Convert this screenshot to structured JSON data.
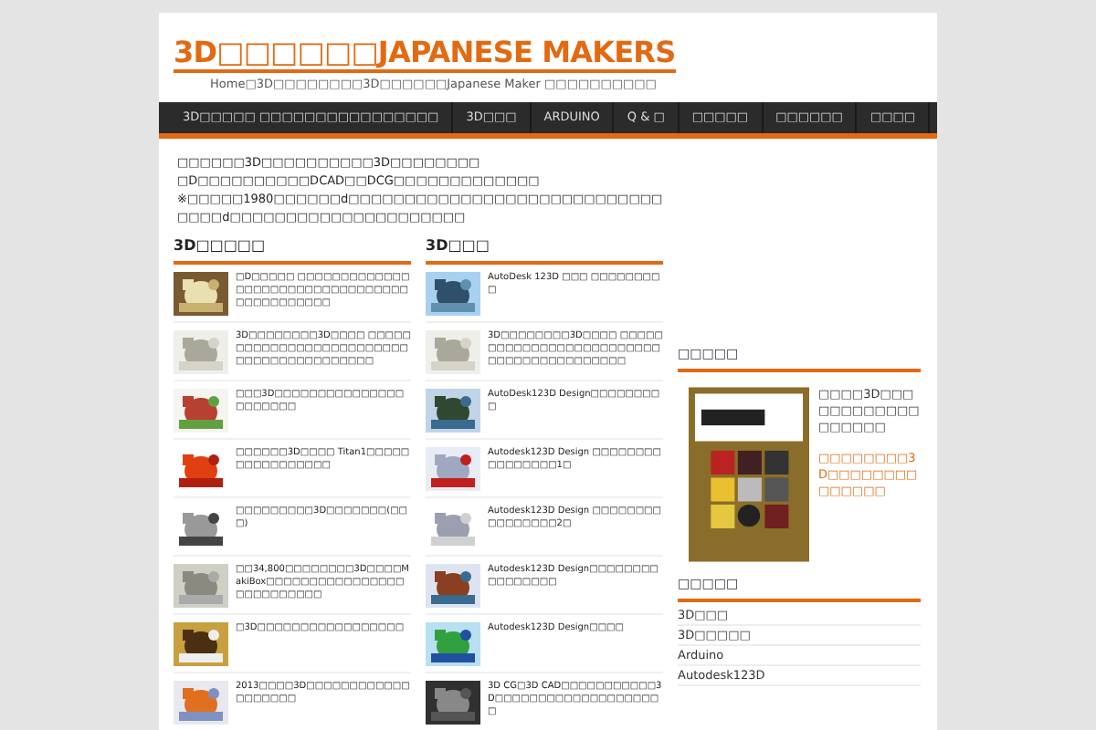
{
  "site_title": "3D□□□□□□JAPANESE MAKERS",
  "breadcrumb": "Home□3D□□□□□□□□3D□□□□□□Japanese Maker □□□□□□□□□□",
  "nav": [
    {
      "label": "3D□□□□□ □□□□□□□□□□□□□□□□",
      "selected": false
    },
    {
      "label": "3D□□□",
      "selected": false
    },
    {
      "label": "ARDUINO",
      "selected": false
    },
    {
      "label": "Q & □",
      "selected": false
    },
    {
      "label": "□□□□□",
      "selected": false
    },
    {
      "label": "□□□□□□",
      "selected": false
    },
    {
      "label": "□□□□",
      "selected": false
    }
  ],
  "intro": [
    "□□□□□□3D□□□□□□□□□□3D□□□□□□□□",
    "□D□□□□□□□□□□DCAD□□DCG□□□□□□□□□□□□□",
    "※□□□□□1980□□□□□□d□□□□□□□□□□□□□□□□□□□□□□□□□□□□",
    "□□□□d□□□□□□□□□□□□□□□□□□□□□"
  ],
  "columns": [
    {
      "heading": "3D□□□□□",
      "posts": [
        {
          "title": "□D□□□□□ □□□□□□□□□□□□□□□□□□□□□□□□□□□□□□□□□□□□□□□□□□□□"
        },
        {
          "title": "3D□□□□□□□□3D□□□□ □□□□□□□□□□□□□□□□□□□□□□□□□□□□□□□□□□□□□□□□□"
        },
        {
          "title": "□□□3D□□□□□□□□□□□□□□□□□□□□□□"
        },
        {
          "title": "□□□□□□3D□□□□ Titan1□□□□□□□□□□□□□□□□"
        },
        {
          "title": "□□□□□□□□□3D□□□□□□□(□□□)"
        },
        {
          "title": "□□34,800□□□□□□□□3D□□□□MakiBox□□□□□□□□□□□□□□□□□□□□□□□□□□"
        },
        {
          "title": "□3D□□□□□□□□□□□□□□□□□"
        },
        {
          "title": "2013□□□□3D□□□□□□□□□□□□□□□□□□□"
        }
      ]
    },
    {
      "heading": "3D□□□",
      "posts": [
        {
          "title": "AutoDesk 123D □□□ □□□□□□□□□"
        },
        {
          "title": "3D□□□□□□□□3D□□□□ □□□□□□□□□□□□□□□□□□□□□□□□□□□□□□□□□□□□□□□□□"
        },
        {
          "title": "AutoDesk123D Design□□□□□□□□□"
        },
        {
          "title": "Autodesk123D Design □□□□□□□□□□□□□□□□1□"
        },
        {
          "title": "Autodesk123D Design □□□□□□□□□□□□□□□□2□"
        },
        {
          "title": "Autodesk123D Design□□□□□□□□□□□□□□□□"
        },
        {
          "title": "Autodesk123D Design□□□□"
        },
        {
          "title": "3D CG□3D CAD□□□□□□□□□□□3D□□□□□□□□□□□□□□□□□□□□"
        }
      ]
    }
  ],
  "sidebar": {
    "book_heading": "□□□□□",
    "book_text": "□□□□3D□□□□□□□□□□□□□□□□□□",
    "book_link": "□□□□□□□□3D□□□□□□□□□□□□□□",
    "category_heading": "□□□□□",
    "categories": [
      "3D□□□",
      "3D□□□□□",
      "Arduino",
      "Autodesk123D"
    ]
  }
}
